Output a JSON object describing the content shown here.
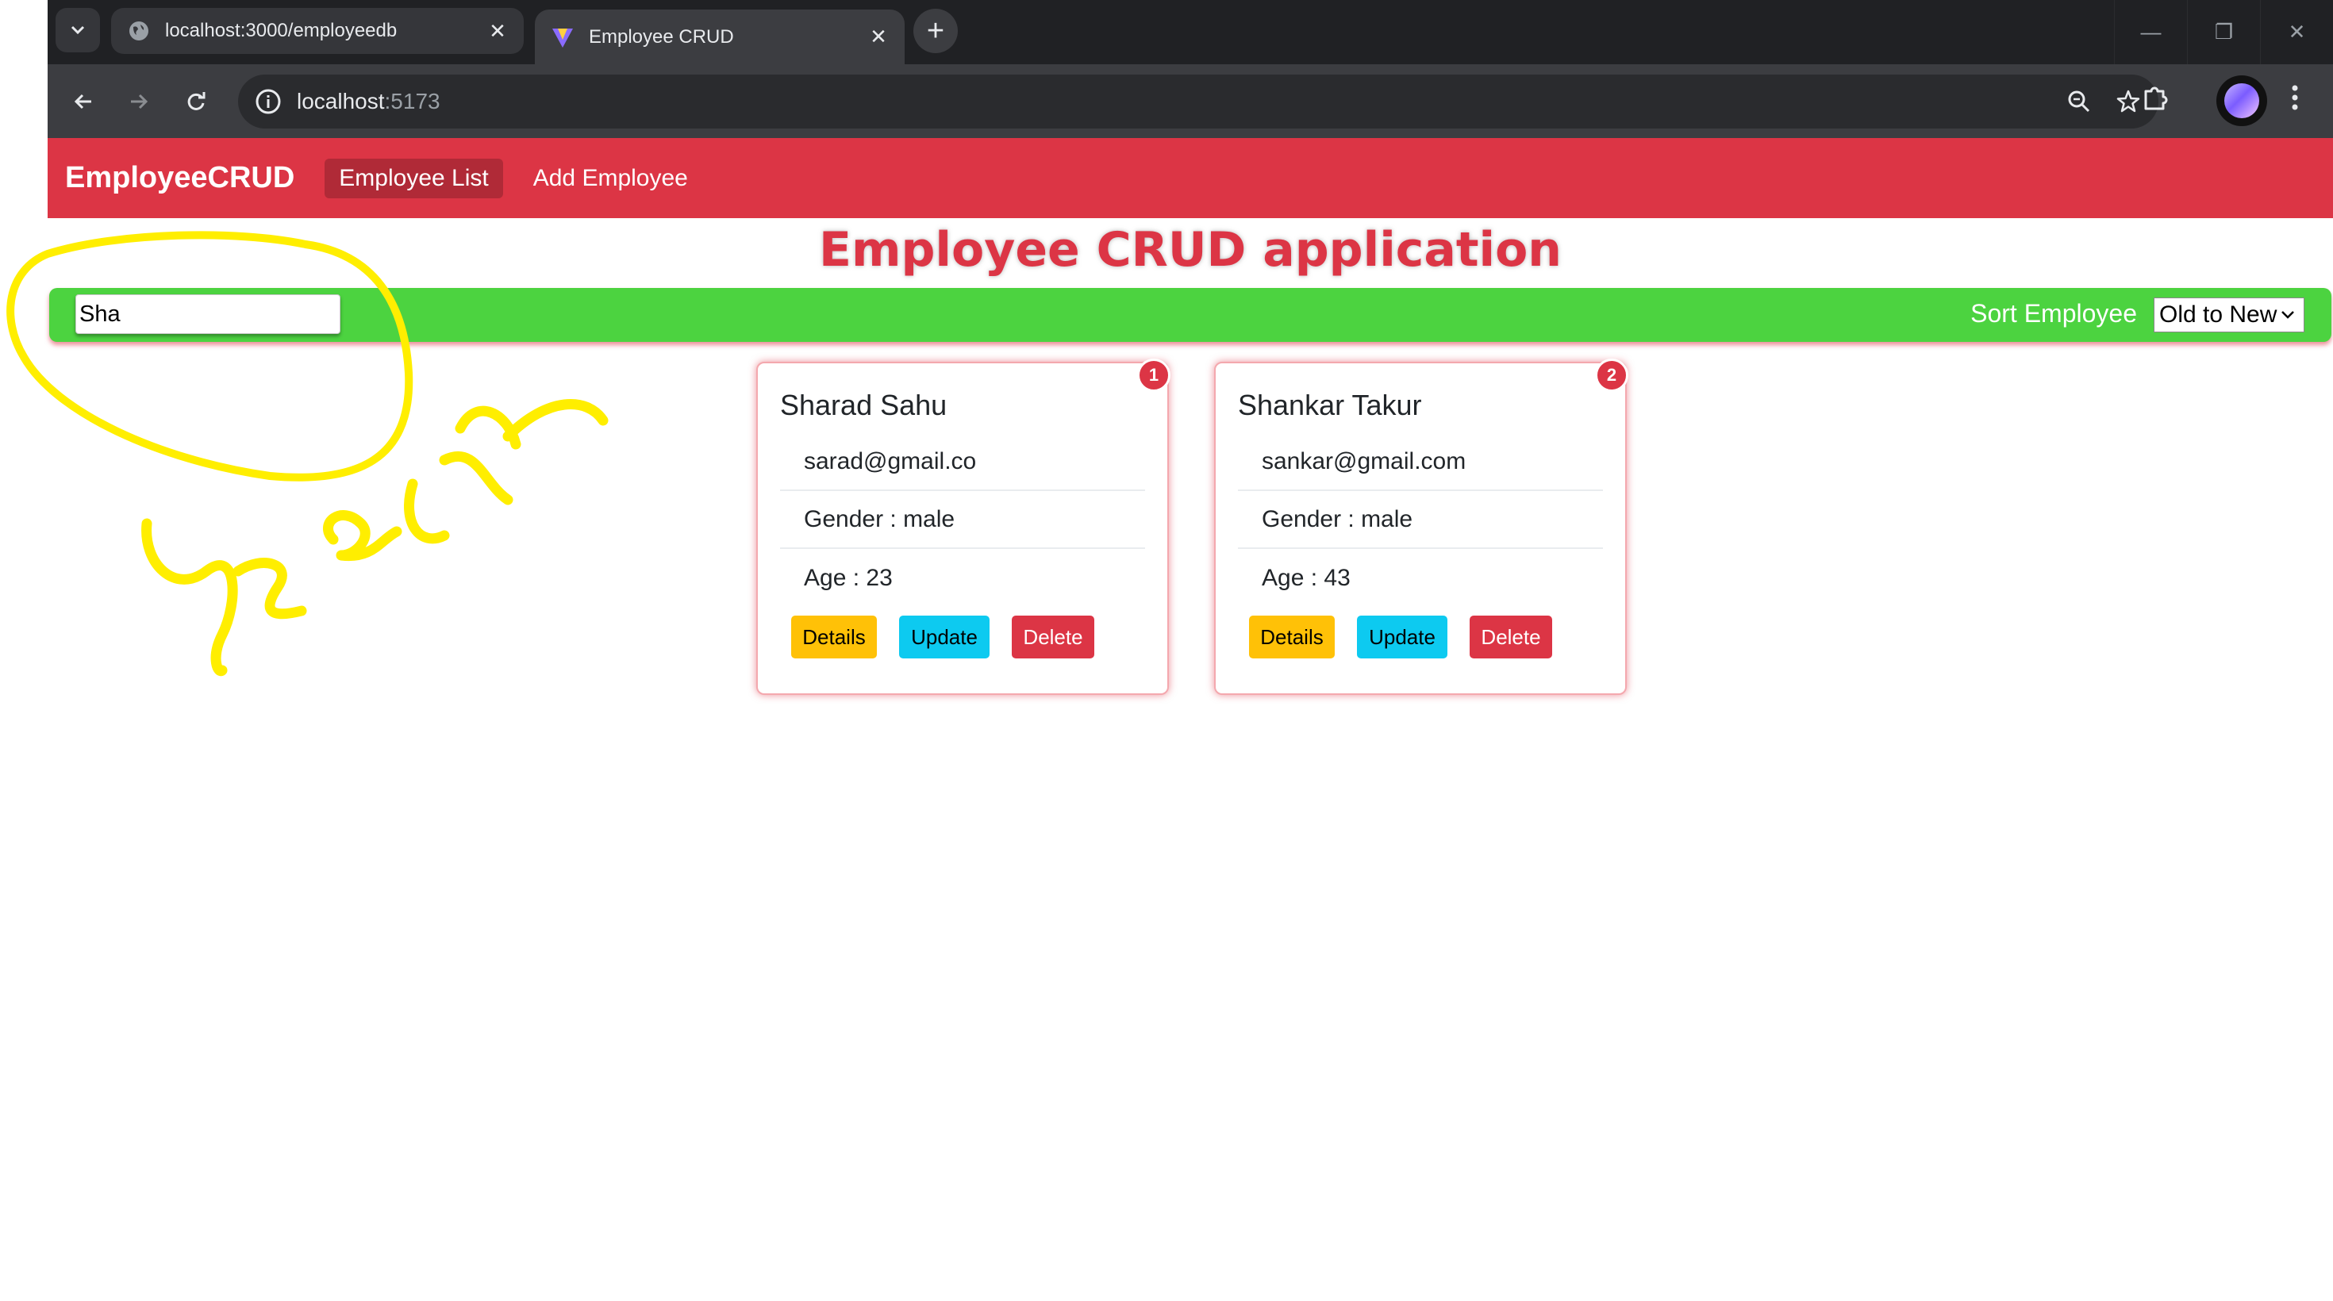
{
  "browser": {
    "tabs": [
      {
        "title": "localhost:3000/employeedb",
        "active": false
      },
      {
        "title": "Employee CRUD",
        "active": true
      }
    ],
    "url": {
      "host": "localhost",
      "port": ":5173"
    }
  },
  "app": {
    "brand": "EmployeeCRUD",
    "nav": {
      "employee_list": "Employee List",
      "add_employee": "Add Employee"
    },
    "page_title": "Employee CRUD application",
    "search": {
      "value": "Sha",
      "placeholder": ""
    },
    "sort": {
      "label": "Sort Employee",
      "selected": "Old to New"
    },
    "buttons": {
      "details": "Details",
      "update": "Update",
      "delete": "Delete"
    },
    "employees": [
      {
        "index": "1",
        "name": "Sharad Sahu",
        "email": "sarad@gmail.co",
        "gender": "Gender : male",
        "age": "Age : 23"
      },
      {
        "index": "2",
        "name": "Shankar Takur",
        "email": "sankar@gmail.com",
        "gender": "Gender : male",
        "age": "Age : 43"
      }
    ]
  },
  "colors": {
    "navbar": "#dc3545",
    "filter_bar": "#4cd340",
    "details_btn": "#ffc107",
    "update_btn": "#0dcaf0",
    "delete_btn": "#dc3545",
    "annotation": "#ffee00"
  },
  "annotation": {
    "handwritten_text": "Search"
  }
}
